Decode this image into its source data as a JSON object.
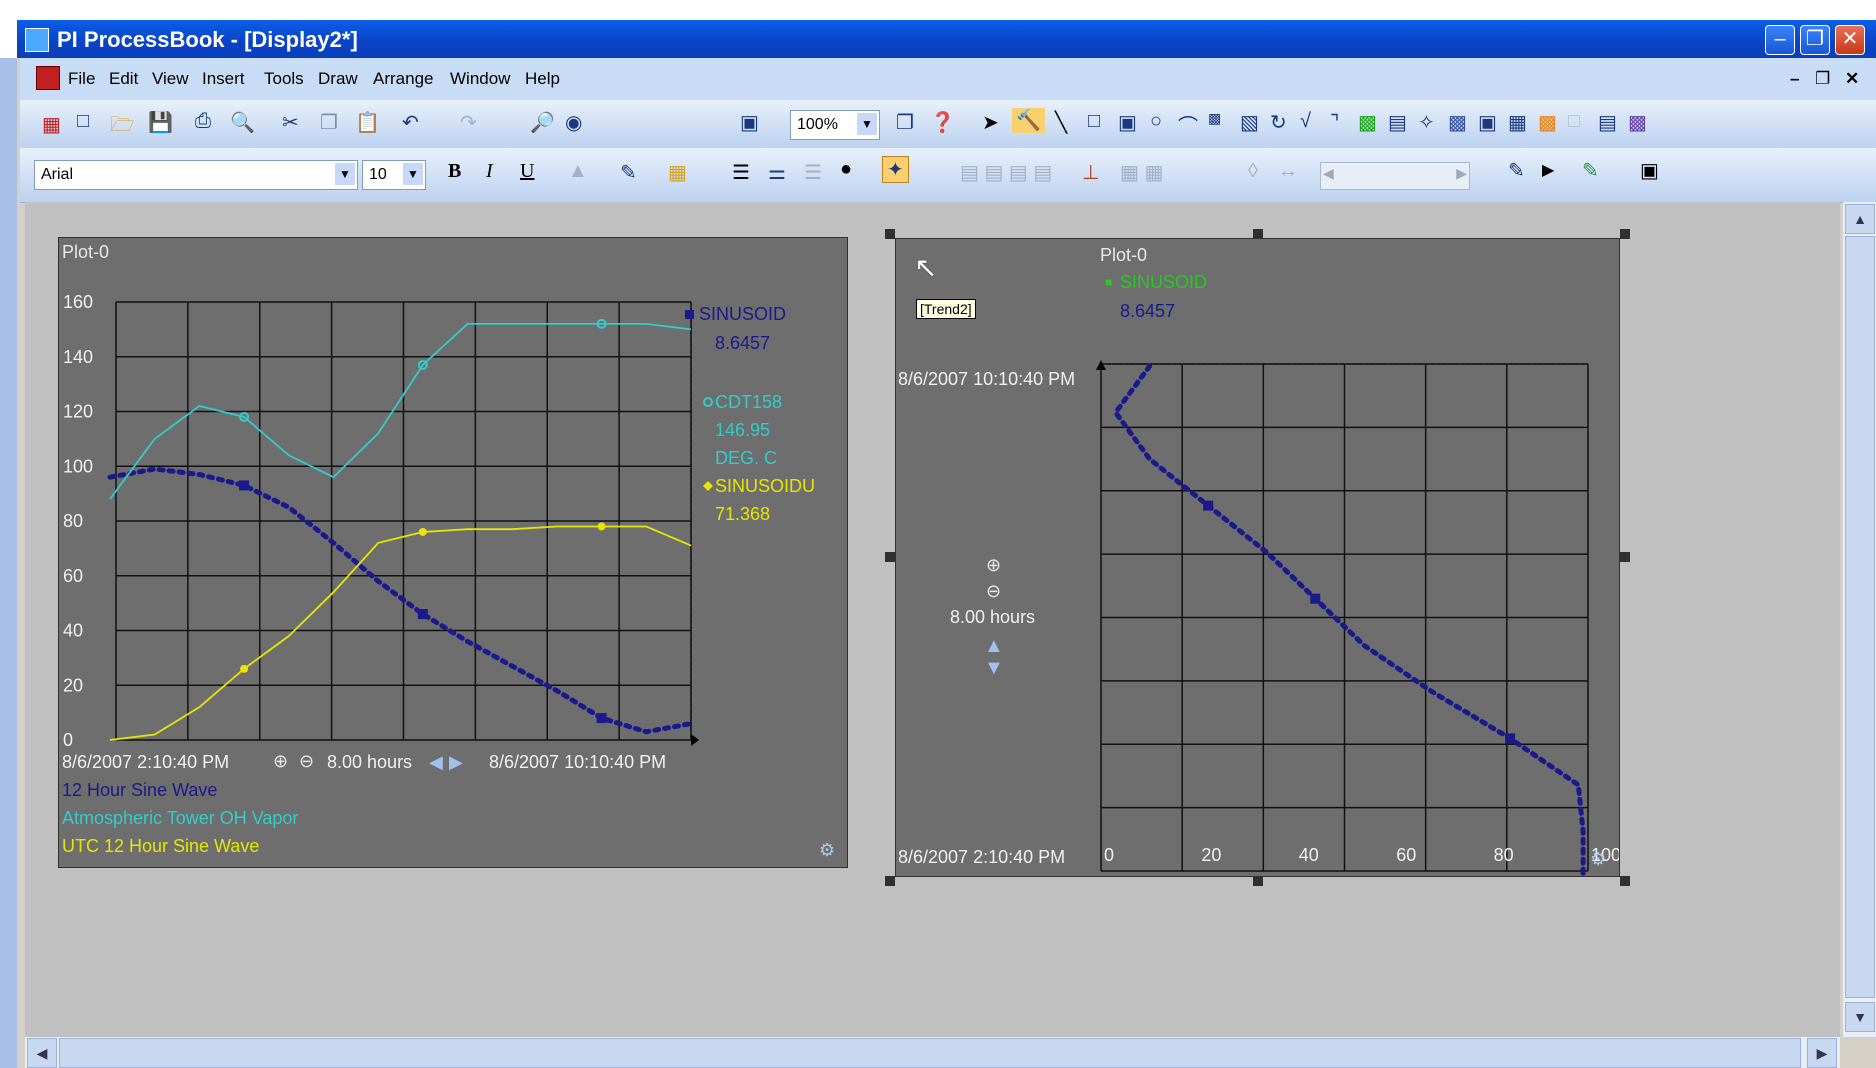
{
  "window": {
    "title": "PI ProcessBook - [Display2*]"
  },
  "menu": [
    "File",
    "Edit",
    "View",
    "Insert",
    "Tools",
    "Draw",
    "Arrange",
    "Window",
    "Help"
  ],
  "toolbar": {
    "zoom": "100%",
    "font_name": "Arial",
    "font_size": "10",
    "bold": "B",
    "italic": "I",
    "underline": "U"
  },
  "trend1": {
    "title": "Plot-0",
    "y_ticks": [
      "160",
      "140",
      "120",
      "100",
      "80",
      "60",
      "40",
      "20",
      "0"
    ],
    "start_time": "8/6/2007 2:10:40 PM",
    "end_time": "8/6/2007 10:10:40 PM",
    "duration": "8.00 hours",
    "legend": [
      {
        "tag": "SINUSOID",
        "value": "8.6457",
        "unit": "",
        "color": "#1a1a8c"
      },
      {
        "tag": "CDT158",
        "value": "146.95",
        "unit": "DEG. C",
        "color": "#33cccc"
      },
      {
        "tag": "SINUSOIDU",
        "value": "71.368",
        "unit": "",
        "color": "#e6e600"
      }
    ],
    "descriptions": [
      "12 Hour Sine Wave",
      "Atmospheric Tower OH Vapor",
      "UTC 12 Hour Sine Wave"
    ]
  },
  "trend2": {
    "title": "Plot-0",
    "tooltip": "[Trend2]",
    "legend": {
      "tag": "SINUSOID",
      "value": "8.6457",
      "tag_color": "#22cc22",
      "value_color": "#1a1a8c"
    },
    "top_time": "8/6/2007 10:10:40 PM",
    "bottom_time": "8/6/2007 2:10:40 PM",
    "duration": "8.00 hours",
    "x_ticks": [
      "0",
      "20",
      "40",
      "60",
      "80",
      "100"
    ]
  },
  "chart_data": [
    {
      "type": "line",
      "title": "Plot-0",
      "x": [
        "8/6/2007 2:10:40 PM",
        "8/6/2007 10:10:40 PM"
      ],
      "ylim": [
        0,
        160
      ],
      "series": [
        {
          "name": "SINUSOID",
          "color": "#1a1a8c",
          "values": [
            96,
            99,
            97,
            93,
            85,
            72,
            58,
            46,
            36,
            27,
            18,
            8,
            3,
            6
          ]
        },
        {
          "name": "CDT158",
          "color": "#33cccc",
          "values": [
            88,
            110,
            122,
            118,
            104,
            96,
            112,
            137,
            152,
            152,
            152,
            152,
            152,
            150
          ]
        },
        {
          "name": "SINUSOIDU",
          "color": "#e6e600",
          "values": [
            0,
            2,
            12,
            26,
            38,
            54,
            72,
            76,
            77,
            77,
            78,
            78,
            78,
            71
          ]
        }
      ]
    },
    {
      "type": "line",
      "title": "Plot-0",
      "xlim": [
        0,
        100
      ],
      "series": [
        {
          "name": "SINUSOID",
          "color": "#1a1a8c",
          "values": [
            10,
            3,
            10,
            22,
            34,
            44,
            54,
            68,
            84,
            98,
            99,
            99
          ]
        }
      ]
    }
  ]
}
